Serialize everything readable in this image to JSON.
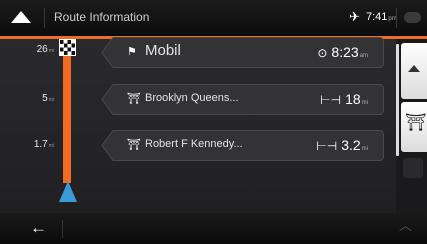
{
  "header": {
    "title": "Route Information",
    "time": "7:41",
    "time_suffix": "pm"
  },
  "distances": [
    {
      "value": "26",
      "unit": "mi"
    },
    {
      "value": "5",
      "unit": "mi"
    },
    {
      "value": "1.7",
      "unit": "mi"
    }
  ],
  "route_items": [
    {
      "icon": "destination-flag-icon",
      "name": "Mobil",
      "value": "8:23",
      "unit": "am",
      "value_icon": "clock-icon"
    },
    {
      "icon": "toll-icon",
      "name": "Brooklyn Queens...",
      "value": "18",
      "unit": "mi",
      "value_icon": "distance-icon"
    },
    {
      "icon": "toll-icon",
      "name": "Robert F Kennedy...",
      "value": "3.2",
      "unit": "mi",
      "value_icon": "distance-icon"
    }
  ],
  "colors": {
    "accent": "#f26b22",
    "car": "#3d9ad8"
  }
}
